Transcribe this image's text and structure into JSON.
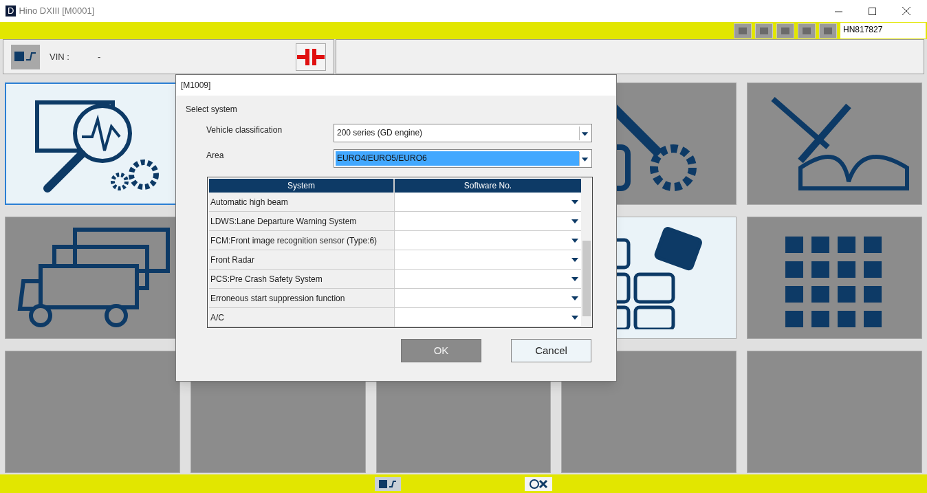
{
  "window": {
    "title": "Hino DXIII [M0001]",
    "app_letter": "D"
  },
  "toolbar": {
    "user_id": "HN817827"
  },
  "vin": {
    "label": "VIN :",
    "value": "-"
  },
  "tiles": [
    {
      "kind": "diagnosis",
      "selected": true,
      "highlighted": true
    },
    {
      "kind": "covered"
    },
    {
      "kind": "covered"
    },
    {
      "kind": "wrench-gear",
      "selected": false,
      "highlighted": false
    },
    {
      "kind": "tools-book",
      "selected": false,
      "highlighted": false
    },
    {
      "kind": "trucks",
      "selected": false,
      "highlighted": false
    },
    {
      "kind": "covered"
    },
    {
      "kind": "covered"
    },
    {
      "kind": "blocks",
      "selected": false,
      "highlighted": true
    },
    {
      "kind": "cubes",
      "selected": false,
      "highlighted": false
    },
    {
      "kind": "blank",
      "selected": false,
      "highlighted": false
    },
    {
      "kind": "blank",
      "selected": false,
      "highlighted": false
    },
    {
      "kind": "blank",
      "selected": false,
      "highlighted": false
    },
    {
      "kind": "blank",
      "selected": false,
      "highlighted": false
    },
    {
      "kind": "blank",
      "selected": false,
      "highlighted": false
    }
  ],
  "dialog": {
    "title": "[M1009]",
    "heading": "Select system",
    "fields": [
      {
        "label": "Vehicle classification",
        "value": "200 series (GD engine)",
        "selected": false
      },
      {
        "label": "Area",
        "value": "EURO4/EURO5/EURO6",
        "selected": true
      }
    ],
    "table": {
      "columns": [
        "System",
        "Software No."
      ],
      "rows": [
        {
          "system": "Automatic high beam"
        },
        {
          "system": "LDWS:Lane Departure Warning System"
        },
        {
          "system": "FCM:Front image recognition sensor (Type:6)"
        },
        {
          "system": "Front Radar"
        },
        {
          "system": "PCS:Pre Crash Safety System"
        },
        {
          "system": "Erroneous start suppression function"
        },
        {
          "system": "A/C"
        }
      ]
    },
    "buttons": [
      {
        "label": "OK",
        "disabled": true
      },
      {
        "label": "Cancel",
        "disabled": false
      }
    ]
  }
}
